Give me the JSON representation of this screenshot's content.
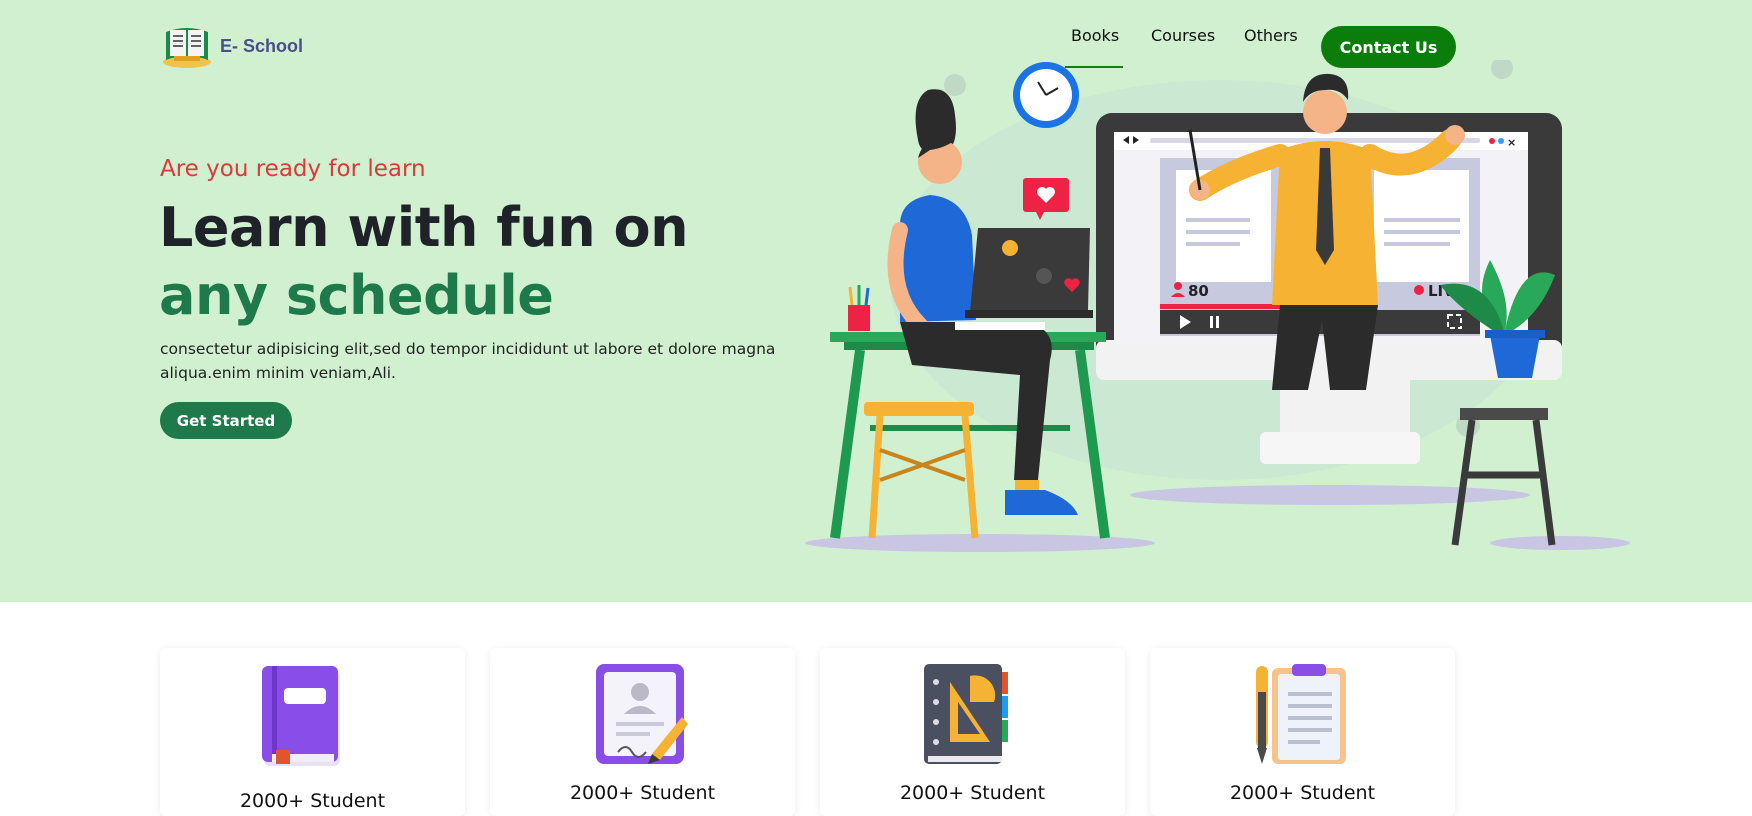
{
  "header": {
    "logo_text": "E- School",
    "nav": [
      {
        "label": "Books",
        "active": true
      },
      {
        "label": "Courses",
        "active": false
      },
      {
        "label": "Others",
        "active": false
      }
    ],
    "contact_label": "Contact Us"
  },
  "hero": {
    "subtitle": "Are you ready for learn",
    "title_line1": "Learn with fun on",
    "title_line2": "any schedule",
    "description": "consectetur adipisicing elit,sed do tempor incididunt ut labore et dolore magna aliqua.enim minim veniam,Ali.",
    "cta_label": "Get Started",
    "illustration": {
      "viewer_count": "80",
      "live_label": "LIVE"
    }
  },
  "cards": [
    {
      "icon": "book-icon",
      "label": "2000+ Student"
    },
    {
      "icon": "certificate-icon",
      "label": "2000+ Student"
    },
    {
      "icon": "notebook-icon",
      "label": "2000+ Student"
    },
    {
      "icon": "clipboard-icon",
      "label": "2000+ Student"
    }
  ],
  "colors": {
    "hero_bg": "#d0f0d0",
    "brand_green": "#0a7d0a",
    "accent_green": "#1e7a4a",
    "subtitle_red": "#d93a3a",
    "logo_text": "#4a4f8c"
  }
}
